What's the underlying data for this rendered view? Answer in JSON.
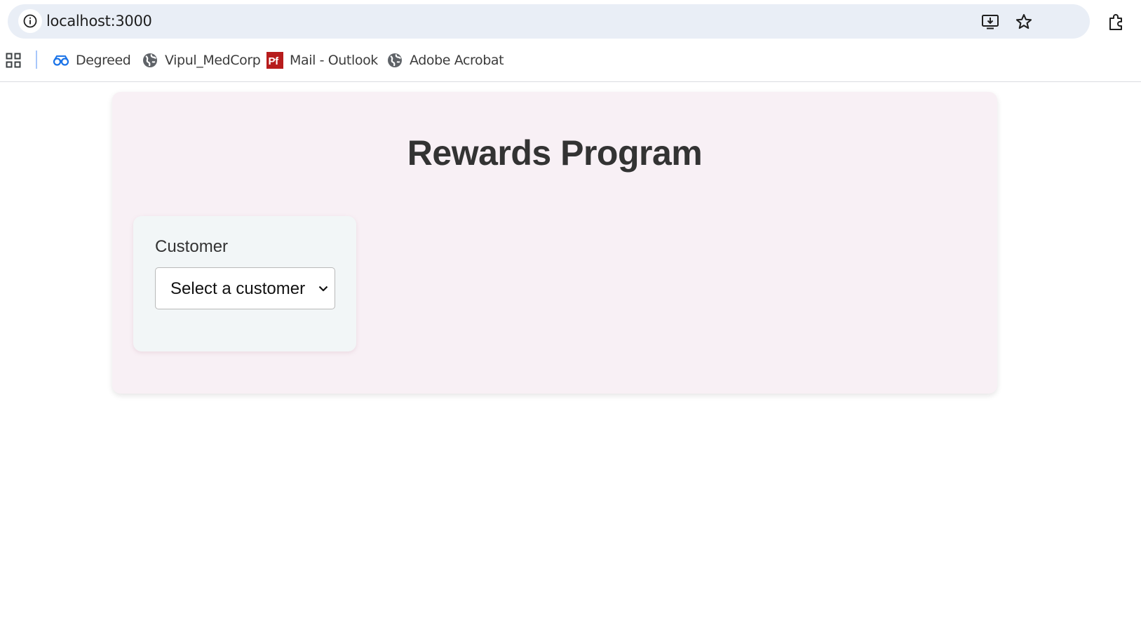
{
  "browser": {
    "url": "localhost:3000",
    "icons": {
      "site_info": "info-icon",
      "install": "install-app-icon",
      "bookmark_star": "star-icon",
      "extensions": "puzzle-piece-icon",
      "apps": "apps-grid-icon"
    }
  },
  "bookmarks": [
    {
      "label": "Degreed",
      "icon": "degreed-glasses-icon",
      "color": "#1a73e8"
    },
    {
      "label": "Vipul_MedCorp",
      "icon": "globe-icon",
      "color": "#5f6368"
    },
    {
      "label": "Mail - Outlook",
      "icon": "pdf-pf-icon",
      "color": "#c62828"
    },
    {
      "label": "Adobe Acrobat",
      "icon": "globe-icon",
      "color": "#5f6368"
    }
  ],
  "app": {
    "title": "Rewards Program",
    "filter": {
      "label": "Customer",
      "select_value": "Select a customer"
    }
  },
  "colors": {
    "card_background": "#f8f0f5",
    "filter_background": "#f2f6f7",
    "title_color": "#333333"
  }
}
